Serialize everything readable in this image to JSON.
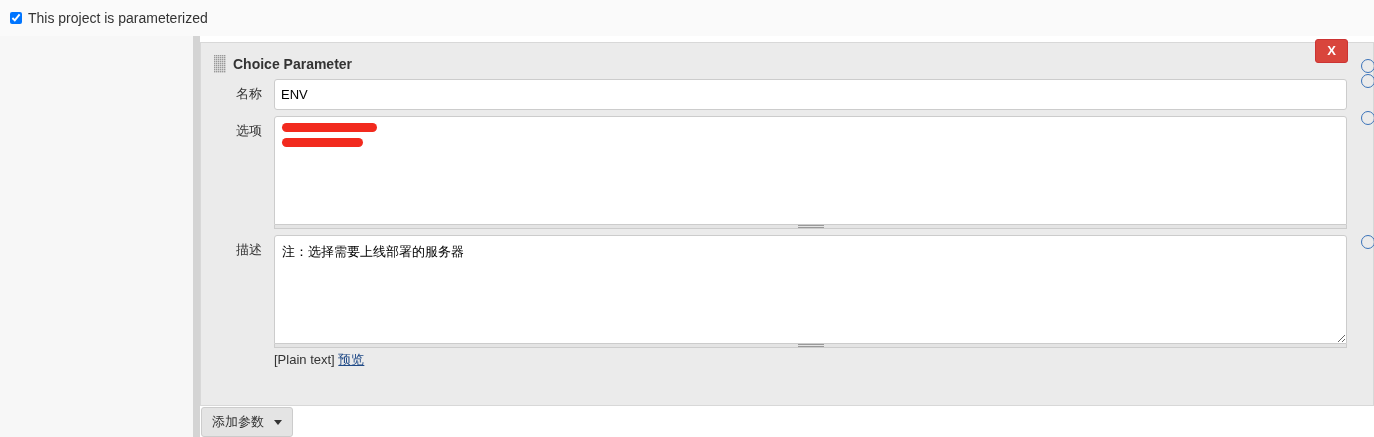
{
  "parameterized": {
    "label": "This project is parameterized",
    "checked": true
  },
  "parameter": {
    "title": "Choice Parameter",
    "delete_label": "X",
    "fields": [
      {
        "kind": "input",
        "label": "名称",
        "value": "ENV"
      },
      {
        "kind": "textarea",
        "label": "选项",
        "redacted": true
      },
      {
        "kind": "textarea",
        "label": "描述",
        "value": "注：选择需要上线部署的服务器",
        "format": "[Plain text]",
        "preview": "预览"
      }
    ]
  },
  "add_button": {
    "label": "添加参数"
  }
}
